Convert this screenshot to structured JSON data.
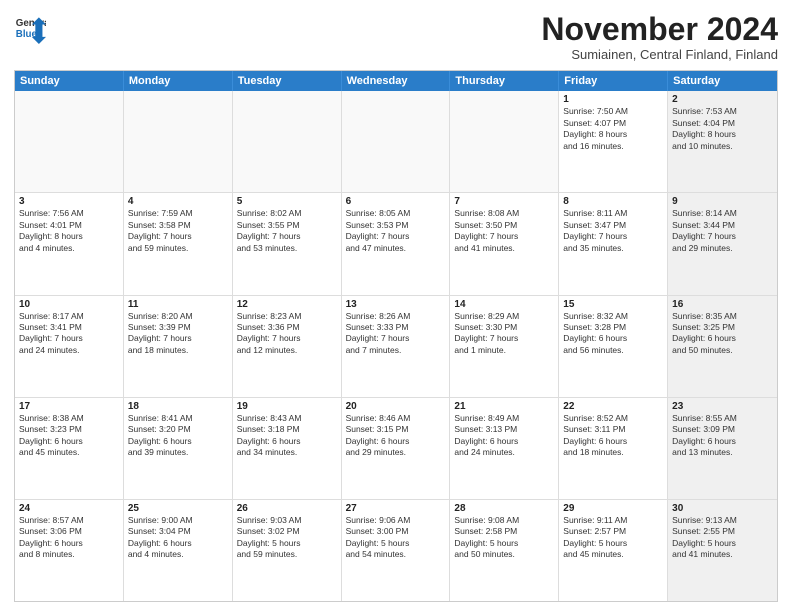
{
  "header": {
    "logo_general": "General",
    "logo_blue": "Blue",
    "month_title": "November 2024",
    "subtitle": "Sumiainen, Central Finland, Finland"
  },
  "day_headers": [
    "Sunday",
    "Monday",
    "Tuesday",
    "Wednesday",
    "Thursday",
    "Friday",
    "Saturday"
  ],
  "weeks": [
    [
      {
        "day": "",
        "info": "",
        "empty": true
      },
      {
        "day": "",
        "info": "",
        "empty": true
      },
      {
        "day": "",
        "info": "",
        "empty": true
      },
      {
        "day": "",
        "info": "",
        "empty": true
      },
      {
        "day": "",
        "info": "",
        "empty": true
      },
      {
        "day": "1",
        "info": "Sunrise: 7:50 AM\nSunset: 4:07 PM\nDaylight: 8 hours\nand 16 minutes.",
        "empty": false
      },
      {
        "day": "2",
        "info": "Sunrise: 7:53 AM\nSunset: 4:04 PM\nDaylight: 8 hours\nand 10 minutes.",
        "empty": false,
        "shaded": true
      }
    ],
    [
      {
        "day": "3",
        "info": "Sunrise: 7:56 AM\nSunset: 4:01 PM\nDaylight: 8 hours\nand 4 minutes.",
        "empty": false
      },
      {
        "day": "4",
        "info": "Sunrise: 7:59 AM\nSunset: 3:58 PM\nDaylight: 7 hours\nand 59 minutes.",
        "empty": false
      },
      {
        "day": "5",
        "info": "Sunrise: 8:02 AM\nSunset: 3:55 PM\nDaylight: 7 hours\nand 53 minutes.",
        "empty": false
      },
      {
        "day": "6",
        "info": "Sunrise: 8:05 AM\nSunset: 3:53 PM\nDaylight: 7 hours\nand 47 minutes.",
        "empty": false
      },
      {
        "day": "7",
        "info": "Sunrise: 8:08 AM\nSunset: 3:50 PM\nDaylight: 7 hours\nand 41 minutes.",
        "empty": false
      },
      {
        "day": "8",
        "info": "Sunrise: 8:11 AM\nSunset: 3:47 PM\nDaylight: 7 hours\nand 35 minutes.",
        "empty": false
      },
      {
        "day": "9",
        "info": "Sunrise: 8:14 AM\nSunset: 3:44 PM\nDaylight: 7 hours\nand 29 minutes.",
        "empty": false,
        "shaded": true
      }
    ],
    [
      {
        "day": "10",
        "info": "Sunrise: 8:17 AM\nSunset: 3:41 PM\nDaylight: 7 hours\nand 24 minutes.",
        "empty": false
      },
      {
        "day": "11",
        "info": "Sunrise: 8:20 AM\nSunset: 3:39 PM\nDaylight: 7 hours\nand 18 minutes.",
        "empty": false
      },
      {
        "day": "12",
        "info": "Sunrise: 8:23 AM\nSunset: 3:36 PM\nDaylight: 7 hours\nand 12 minutes.",
        "empty": false
      },
      {
        "day": "13",
        "info": "Sunrise: 8:26 AM\nSunset: 3:33 PM\nDaylight: 7 hours\nand 7 minutes.",
        "empty": false
      },
      {
        "day": "14",
        "info": "Sunrise: 8:29 AM\nSunset: 3:30 PM\nDaylight: 7 hours\nand 1 minute.",
        "empty": false
      },
      {
        "day": "15",
        "info": "Sunrise: 8:32 AM\nSunset: 3:28 PM\nDaylight: 6 hours\nand 56 minutes.",
        "empty": false
      },
      {
        "day": "16",
        "info": "Sunrise: 8:35 AM\nSunset: 3:25 PM\nDaylight: 6 hours\nand 50 minutes.",
        "empty": false,
        "shaded": true
      }
    ],
    [
      {
        "day": "17",
        "info": "Sunrise: 8:38 AM\nSunset: 3:23 PM\nDaylight: 6 hours\nand 45 minutes.",
        "empty": false
      },
      {
        "day": "18",
        "info": "Sunrise: 8:41 AM\nSunset: 3:20 PM\nDaylight: 6 hours\nand 39 minutes.",
        "empty": false
      },
      {
        "day": "19",
        "info": "Sunrise: 8:43 AM\nSunset: 3:18 PM\nDaylight: 6 hours\nand 34 minutes.",
        "empty": false
      },
      {
        "day": "20",
        "info": "Sunrise: 8:46 AM\nSunset: 3:15 PM\nDaylight: 6 hours\nand 29 minutes.",
        "empty": false
      },
      {
        "day": "21",
        "info": "Sunrise: 8:49 AM\nSunset: 3:13 PM\nDaylight: 6 hours\nand 24 minutes.",
        "empty": false
      },
      {
        "day": "22",
        "info": "Sunrise: 8:52 AM\nSunset: 3:11 PM\nDaylight: 6 hours\nand 18 minutes.",
        "empty": false
      },
      {
        "day": "23",
        "info": "Sunrise: 8:55 AM\nSunset: 3:09 PM\nDaylight: 6 hours\nand 13 minutes.",
        "empty": false,
        "shaded": true
      }
    ],
    [
      {
        "day": "24",
        "info": "Sunrise: 8:57 AM\nSunset: 3:06 PM\nDaylight: 6 hours\nand 8 minutes.",
        "empty": false
      },
      {
        "day": "25",
        "info": "Sunrise: 9:00 AM\nSunset: 3:04 PM\nDaylight: 6 hours\nand 4 minutes.",
        "empty": false
      },
      {
        "day": "26",
        "info": "Sunrise: 9:03 AM\nSunset: 3:02 PM\nDaylight: 5 hours\nand 59 minutes.",
        "empty": false
      },
      {
        "day": "27",
        "info": "Sunrise: 9:06 AM\nSunset: 3:00 PM\nDaylight: 5 hours\nand 54 minutes.",
        "empty": false
      },
      {
        "day": "28",
        "info": "Sunrise: 9:08 AM\nSunset: 2:58 PM\nDaylight: 5 hours\nand 50 minutes.",
        "empty": false
      },
      {
        "day": "29",
        "info": "Sunrise: 9:11 AM\nSunset: 2:57 PM\nDaylight: 5 hours\nand 45 minutes.",
        "empty": false
      },
      {
        "day": "30",
        "info": "Sunrise: 9:13 AM\nSunset: 2:55 PM\nDaylight: 5 hours\nand 41 minutes.",
        "empty": false,
        "shaded": true
      }
    ]
  ]
}
